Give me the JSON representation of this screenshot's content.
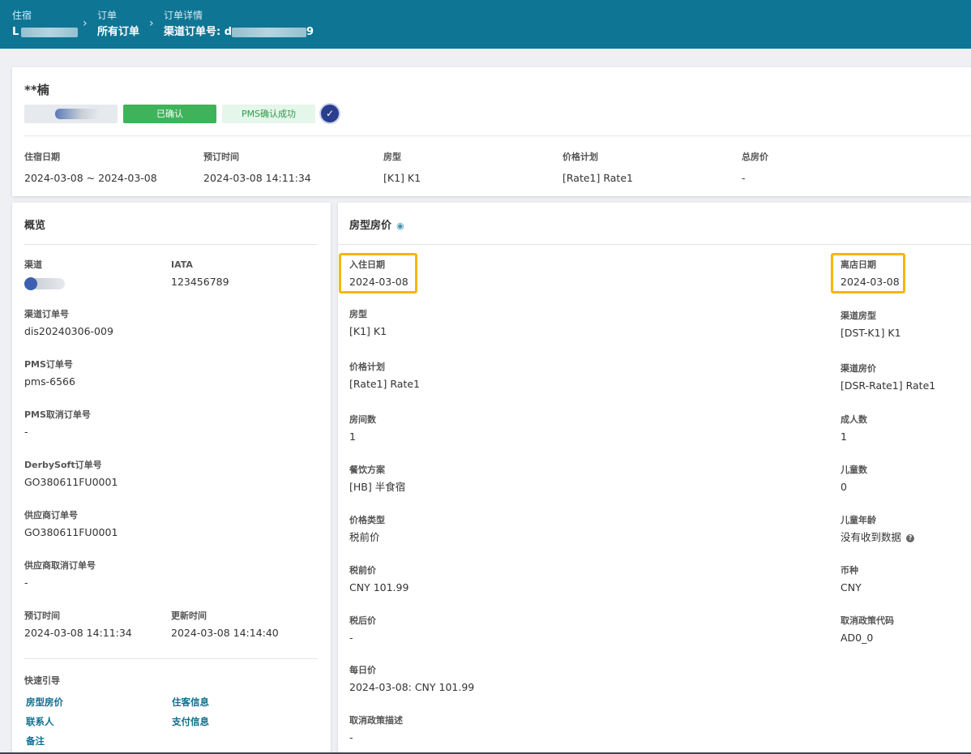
{
  "breadcrumb": {
    "items": [
      {
        "label": "住宿",
        "value": "L"
      },
      {
        "label": "订单",
        "value": "所有订单"
      },
      {
        "label": "订单详情",
        "value_prefix": "渠道订单号: d",
        "value_suffix": "9"
      }
    ]
  },
  "header": {
    "guest_name": "**楠",
    "status_confirmed": "已确认",
    "pms_status": "PMS确认成功",
    "fields": [
      {
        "label": "住宿日期",
        "value": "2024-03-08 ~ 2024-03-08"
      },
      {
        "label": "预订时间",
        "value": "2024-03-08 14:11:34"
      },
      {
        "label": "房型",
        "value": "[K1] K1"
      },
      {
        "label": "价格计划",
        "value": "[Rate1] Rate1"
      },
      {
        "label": "总房价",
        "value": "-"
      }
    ]
  },
  "overview": {
    "title": "概览",
    "channel_label": "渠道",
    "iata_label": "IATA",
    "iata_value": "123456789",
    "channel_order_label": "渠道订单号",
    "channel_order_value": "dis20240306-009",
    "pms_order_label": "PMS订单号",
    "pms_order_value": "pms-6566",
    "pms_cancel_label": "PMS取消订单号",
    "pms_cancel_value": "-",
    "derby_label": "DerbySoft订单号",
    "derby_value": "GO380611FU0001",
    "supplier_order_label": "供应商订单号",
    "supplier_order_value": "GO380611FU0001",
    "supplier_cancel_label": "供应商取消订单号",
    "supplier_cancel_value": "-",
    "booking_time_label": "预订时间",
    "booking_time_value": "2024-03-08 14:11:34",
    "update_time_label": "更新时间",
    "update_time_value": "2024-03-08 14:14:40",
    "quick_nav_title": "快速引导",
    "quick_links": [
      "房型房价",
      "住客信息",
      "联系人",
      "支付信息",
      "备注"
    ]
  },
  "room_rate": {
    "title": "房型房价",
    "left": [
      {
        "label": "入住日期",
        "value": "2024-03-08"
      },
      {
        "label": "房型",
        "value": "[K1] K1"
      },
      {
        "label": "价格计划",
        "value": "[Rate1] Rate1"
      },
      {
        "label": "房间数",
        "value": "1"
      },
      {
        "label": "餐饮方案",
        "value": "[HB] 半食宿"
      },
      {
        "label": "价格类型",
        "value": "税前价"
      },
      {
        "label": "税前价",
        "value": "CNY 101.99"
      },
      {
        "label": "税后价",
        "value": "-"
      },
      {
        "label": "每日价",
        "value": "2024-03-08: CNY 101.99"
      },
      {
        "label": "取消政策描述",
        "value": "-"
      }
    ],
    "right": [
      {
        "label": "离店日期",
        "value": "2024-03-08"
      },
      {
        "label": "渠道房型",
        "value": "[DST-K1] K1"
      },
      {
        "label": "渠道房价",
        "value": "[DSR-Rate1] Rate1"
      },
      {
        "label": "成人数",
        "value": "1"
      },
      {
        "label": "儿童数",
        "value": "0"
      },
      {
        "label": "儿童年龄",
        "value": "没有收到数据"
      },
      {
        "label": "币种",
        "value": "CNY"
      },
      {
        "label": "取消政策代码",
        "value": "AD0_0"
      }
    ]
  }
}
